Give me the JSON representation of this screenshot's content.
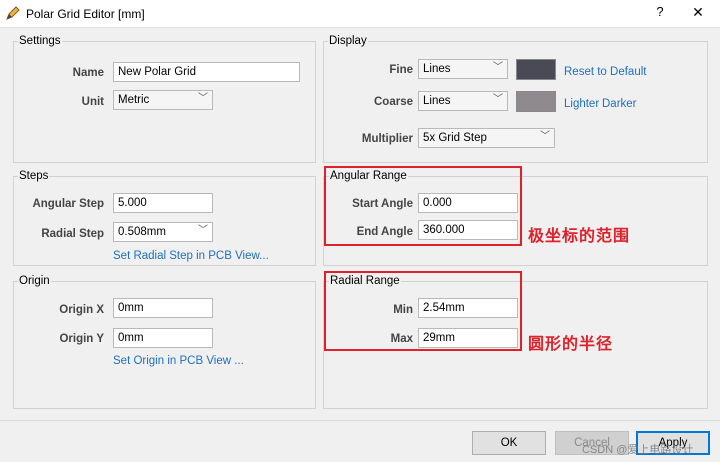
{
  "window": {
    "title": "Polar Grid Editor [mm]",
    "help": "?",
    "close": "✕"
  },
  "settings": {
    "title": "Settings",
    "name_label": "Name",
    "name_value": "New Polar Grid",
    "unit_label": "Unit",
    "unit_value": "Metric"
  },
  "display": {
    "title": "Display",
    "fine_label": "Fine",
    "fine_value": "Lines",
    "fine_color": "#4a4a56",
    "coarse_label": "Coarse",
    "coarse_value": "Lines",
    "coarse_color": "#8e8a8e",
    "reset_link": "Reset to Default",
    "lighter_link": "Lighter",
    "darker_link": "Darker",
    "multiplier_label": "Multiplier",
    "multiplier_value": "5x Grid Step"
  },
  "steps": {
    "title": "Steps",
    "angular_label": "Angular Step",
    "angular_value": "5.000",
    "radial_label": "Radial Step",
    "radial_value": "0.508mm",
    "radial_link": "Set Radial Step in PCB View..."
  },
  "angular_range": {
    "title": "Angular Range",
    "start_label": "Start Angle",
    "start_value": "0.000",
    "end_label": "End Angle",
    "end_value": "360.000",
    "annotation": "极坐标的范围"
  },
  "origin": {
    "title": "Origin",
    "x_label": "Origin X",
    "x_value": "0mm",
    "y_label": "Origin Y",
    "y_value": "0mm",
    "link": "Set Origin in PCB View ..."
  },
  "radial_range": {
    "title": "Radial Range",
    "min_label": "Min",
    "min_value": "2.54mm",
    "max_label": "Max",
    "max_value": "29mm",
    "annotation": "圆形的半径"
  },
  "footer": {
    "ok": "OK",
    "cancel": "Cancel",
    "apply": "Apply"
  },
  "watermark": "CSDN @爱上电路设计",
  "colors": {
    "accent": "#0078d7",
    "link": "#1f6fbf",
    "annotation": "#e0202a"
  },
  "icons": {
    "app": "pencil-grid-icon",
    "chevron": "chevron-down-icon"
  }
}
